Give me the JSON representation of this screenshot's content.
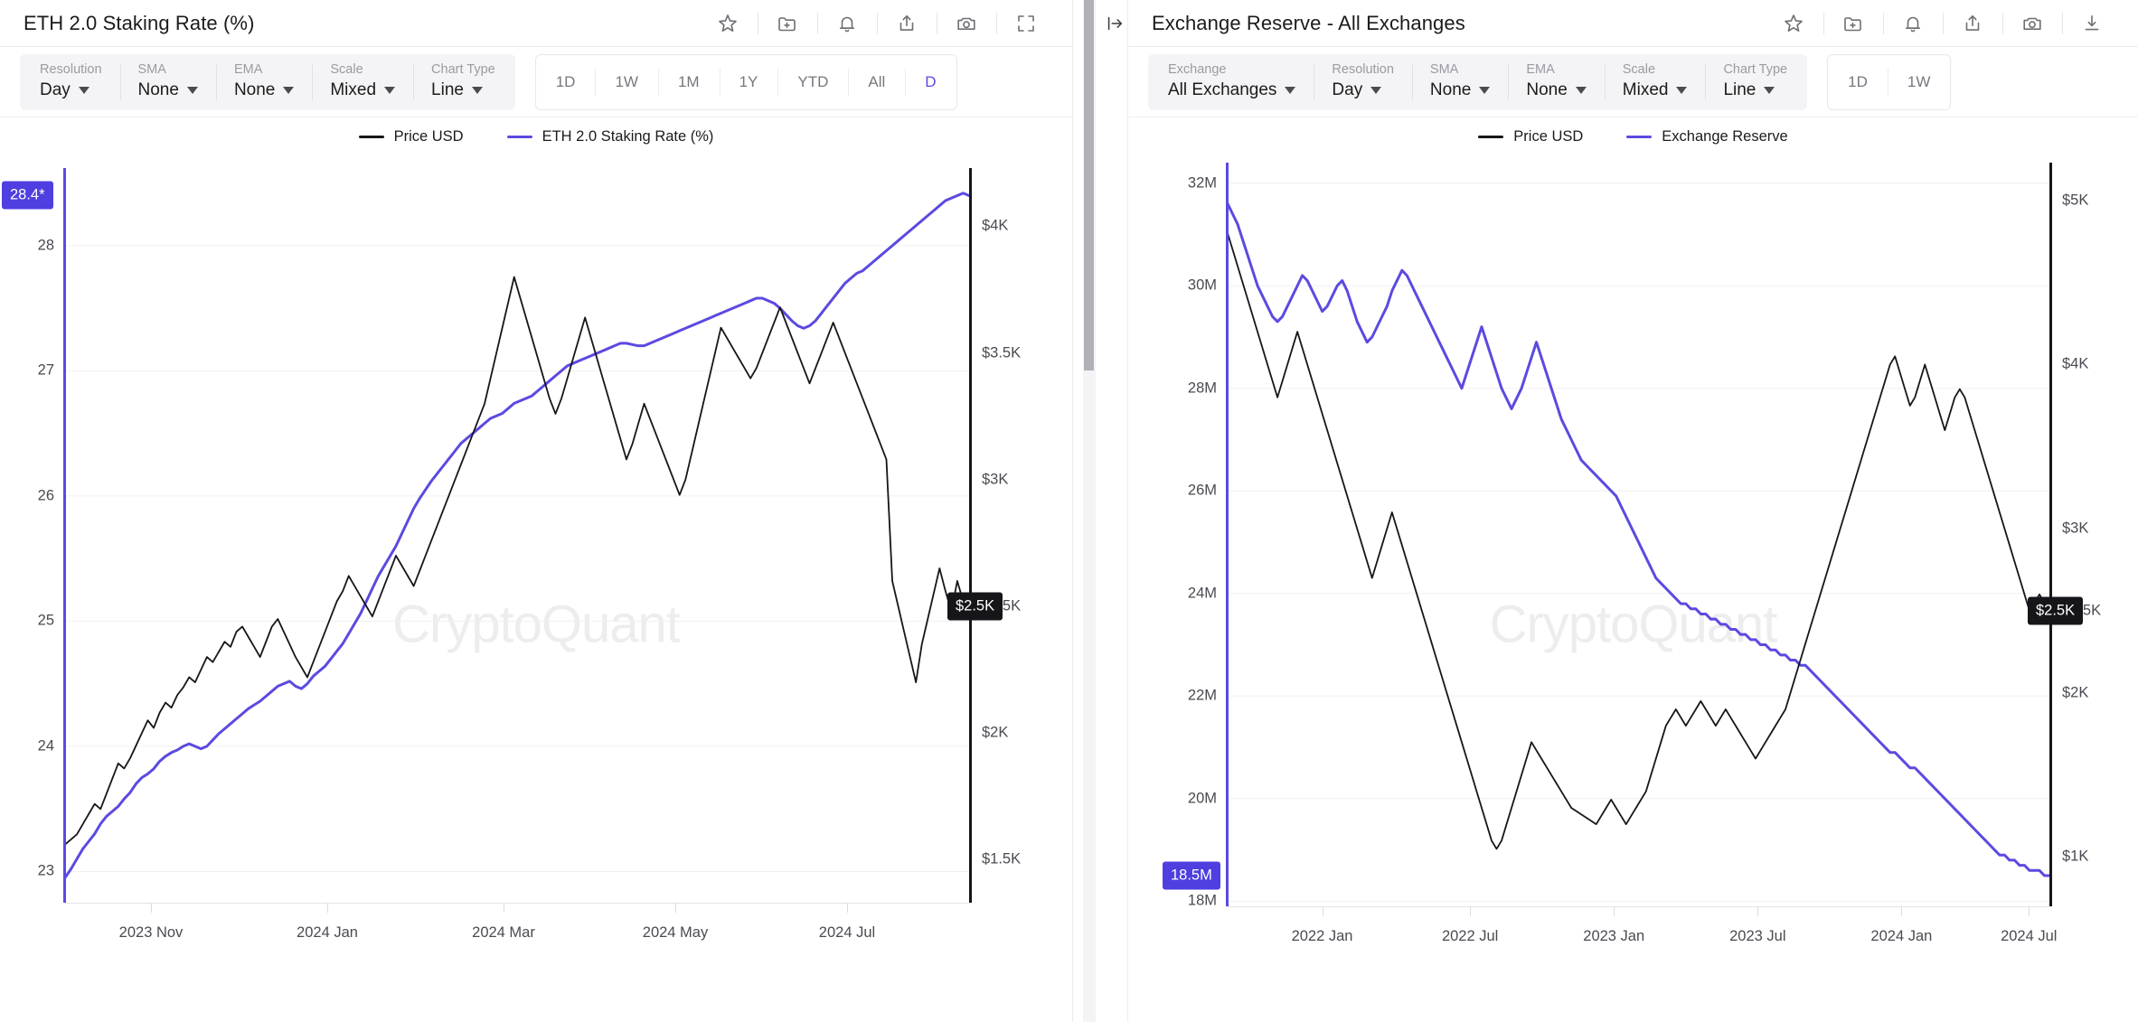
{
  "left_panel": {
    "header": {
      "title": "ETH 2.0 Staking Rate (%)",
      "icons": [
        {
          "name": "star-icon",
          "label": "Favorite"
        },
        {
          "name": "folder-plus-icon",
          "label": "Add to folder"
        },
        {
          "name": "bell-icon",
          "label": "Alert"
        },
        {
          "name": "share-icon",
          "label": "Share"
        },
        {
          "name": "camera-icon",
          "label": "Snapshot"
        },
        {
          "name": "fullscreen-icon",
          "label": "Fullscreen"
        }
      ]
    },
    "controls": [
      {
        "label": "Resolution",
        "value": "Day"
      },
      {
        "label": "SMA",
        "value": "None"
      },
      {
        "label": "EMA",
        "value": "None"
      },
      {
        "label": "Scale",
        "value": "Mixed"
      },
      {
        "label": "Chart Type",
        "value": "Line"
      }
    ],
    "ranges": [
      "1D",
      "1W",
      "1M",
      "1Y",
      "YTD",
      "All"
    ],
    "range_clipped": "D"
  },
  "right_panel": {
    "header": {
      "title": "Exchange Reserve - All Exchanges",
      "icons": [
        {
          "name": "star-icon",
          "label": "Favorite"
        },
        {
          "name": "folder-plus-icon",
          "label": "Add to folder"
        },
        {
          "name": "bell-icon",
          "label": "Alert"
        },
        {
          "name": "share-icon",
          "label": "Share"
        },
        {
          "name": "camera-icon",
          "label": "Snapshot"
        },
        {
          "name": "download-icon",
          "label": "Download"
        }
      ]
    },
    "controls": [
      {
        "label": "Exchange",
        "value": "All Exchanges"
      },
      {
        "label": "Resolution",
        "value": "Day"
      },
      {
        "label": "SMA",
        "value": "None"
      },
      {
        "label": "EMA",
        "value": "None"
      },
      {
        "label": "Scale",
        "value": "Mixed"
      },
      {
        "label": "Chart Type",
        "value": "Line"
      }
    ],
    "ranges": [
      "1D",
      "1W"
    ]
  },
  "gutter": {
    "collapse_icon": "collapse-right-icon"
  },
  "watermark": "CryptoQuant",
  "colors": {
    "metric_purple": "#5b4ae0",
    "price_black": "#16161a",
    "badge_purple": "#4f3fe0",
    "badge_black": "#16161a",
    "grid": "#f0f0f2"
  },
  "chart_data": [
    {
      "id": "eth-staking-rate",
      "type": "line",
      "title": "ETH 2.0 Staking Rate (%)",
      "xlabel": "",
      "ylabel": "ETH 2.0 Staking Rate (%)",
      "y2label": "Price USD",
      "grid": true,
      "legend_position": "top-center",
      "legend": [
        "Price USD",
        "ETH 2.0 Staking Rate (%)"
      ],
      "x_ticks": [
        "2023 Nov",
        "2024 Jan",
        "2024 Mar",
        "2024 May",
        "2024 Jul"
      ],
      "x_tick_positions": [
        0.095,
        0.29,
        0.485,
        0.675,
        0.865
      ],
      "y_ticks": [
        "28",
        "27",
        "26",
        "25",
        "24",
        "23"
      ],
      "y_tick_values": [
        28,
        27,
        26,
        25,
        24,
        23
      ],
      "ylim": [
        22.75,
        28.62
      ],
      "y2_ticks": [
        "$4K",
        "$3.5K",
        "$3K",
        "$2.5K",
        "$2K",
        "$1.5K"
      ],
      "y2_tick_values": [
        4000,
        3500,
        3000,
        2500,
        2000,
        1500
      ],
      "y2lim": [
        1330,
        4230
      ],
      "current_value_badge": {
        "text": "28.4*",
        "value": 28.4,
        "color": "#4f3fe0",
        "axis": "left"
      },
      "current_price_badge": {
        "text": "$2.5K",
        "value": 2500,
        "color": "#16161a",
        "axis": "right"
      },
      "series": [
        {
          "name": "ETH 2.0 Staking Rate (%)",
          "color": "#5b4ae0",
          "axis": "left",
          "values": [
            22.95,
            23.02,
            23.1,
            23.18,
            23.24,
            23.3,
            23.38,
            23.44,
            23.48,
            23.52,
            23.58,
            23.63,
            23.7,
            23.75,
            23.78,
            23.82,
            23.88,
            23.92,
            23.95,
            23.97,
            24.0,
            24.02,
            24.0,
            23.98,
            24.0,
            24.05,
            24.1,
            24.14,
            24.18,
            24.22,
            24.26,
            24.3,
            24.33,
            24.36,
            24.4,
            24.44,
            24.48,
            24.5,
            24.52,
            24.48,
            24.46,
            24.5,
            24.56,
            24.6,
            24.64,
            24.7,
            24.76,
            24.82,
            24.9,
            24.98,
            25.06,
            25.16,
            25.26,
            25.36,
            25.44,
            25.52,
            25.6,
            25.7,
            25.8,
            25.9,
            25.98,
            26.05,
            26.12,
            26.18,
            26.24,
            26.3,
            26.36,
            26.42,
            26.46,
            26.5,
            26.54,
            26.58,
            26.62,
            26.64,
            26.66,
            26.7,
            26.74,
            26.76,
            26.78,
            26.8,
            26.84,
            26.88,
            26.92,
            26.96,
            27.0,
            27.04,
            27.06,
            27.08,
            27.1,
            27.12,
            27.14,
            27.16,
            27.18,
            27.2,
            27.22,
            27.22,
            27.21,
            27.2,
            27.2,
            27.22,
            27.24,
            27.26,
            27.28,
            27.3,
            27.32,
            27.34,
            27.36,
            27.38,
            27.4,
            27.42,
            27.44,
            27.46,
            27.48,
            27.5,
            27.52,
            27.54,
            27.56,
            27.58,
            27.58,
            27.56,
            27.54,
            27.5,
            27.45,
            27.4,
            27.36,
            27.34,
            27.36,
            27.4,
            27.46,
            27.52,
            27.58,
            27.64,
            27.7,
            27.74,
            27.78,
            27.8,
            27.84,
            27.88,
            27.92,
            27.96,
            28.0,
            28.04,
            28.08,
            28.12,
            28.16,
            28.2,
            28.24,
            28.28,
            28.32,
            28.36,
            28.38,
            28.4,
            28.42,
            28.4
          ]
        },
        {
          "name": "Price USD",
          "color": "#16161a",
          "axis": "right",
          "values": [
            1560,
            1580,
            1600,
            1640,
            1680,
            1720,
            1700,
            1760,
            1820,
            1880,
            1860,
            1900,
            1950,
            2000,
            2050,
            2020,
            2080,
            2120,
            2100,
            2150,
            2180,
            2220,
            2200,
            2250,
            2300,
            2280,
            2320,
            2360,
            2340,
            2400,
            2420,
            2380,
            2340,
            2300,
            2360,
            2420,
            2450,
            2400,
            2350,
            2300,
            2260,
            2220,
            2280,
            2340,
            2400,
            2460,
            2520,
            2560,
            2620,
            2580,
            2540,
            2500,
            2460,
            2520,
            2580,
            2640,
            2700,
            2660,
            2620,
            2580,
            2640,
            2700,
            2760,
            2820,
            2880,
            2940,
            3000,
            3060,
            3120,
            3180,
            3240,
            3300,
            3400,
            3500,
            3600,
            3700,
            3800,
            3720,
            3640,
            3560,
            3480,
            3400,
            3320,
            3260,
            3320,
            3400,
            3480,
            3560,
            3640,
            3560,
            3480,
            3400,
            3320,
            3240,
            3160,
            3080,
            3140,
            3220,
            3300,
            3240,
            3180,
            3120,
            3060,
            3000,
            2940,
            3000,
            3100,
            3200,
            3300,
            3400,
            3500,
            3600,
            3560,
            3520,
            3480,
            3440,
            3400,
            3440,
            3500,
            3560,
            3620,
            3680,
            3620,
            3560,
            3500,
            3440,
            3380,
            3440,
            3500,
            3560,
            3620,
            3560,
            3500,
            3440,
            3380,
            3320,
            3260,
            3200,
            3140,
            3080,
            2600,
            2500,
            2400,
            2300,
            2200,
            2350,
            2450,
            2550,
            2650,
            2560,
            2480,
            2600,
            2520,
            2480
          ]
        }
      ]
    },
    {
      "id": "exchange-reserve-all-exchanges",
      "type": "line",
      "title": "Exchange Reserve - All Exchanges",
      "xlabel": "",
      "ylabel": "Exchange Reserve",
      "y2label": "Price USD",
      "grid": true,
      "legend_position": "top-center",
      "legend": [
        "Price USD",
        "Exchange Reserve"
      ],
      "x_ticks": [
        "2022 Jan",
        "2022 Jul",
        "2023 Jan",
        "2023 Jul",
        "2024 Jan",
        "2024 Jul"
      ],
      "x_tick_positions": [
        0.115,
        0.295,
        0.47,
        0.645,
        0.82,
        0.975
      ],
      "y_ticks": [
        "32M",
        "30M",
        "28M",
        "26M",
        "24M",
        "22M",
        "20M",
        "18M"
      ],
      "y_tick_values": [
        32000000,
        30000000,
        28000000,
        26000000,
        24000000,
        22000000,
        20000000,
        18000000
      ],
      "ylim": [
        17900000,
        32400000
      ],
      "y2_ticks": [
        "$5K",
        "$4K",
        "$3K",
        "$2.5K",
        "$2K",
        "$1K"
      ],
      "y2_tick_values": [
        5000,
        4000,
        3000,
        2500,
        2000,
        1000
      ],
      "y2lim": [
        700,
        5230
      ],
      "current_value_badge": {
        "text": "18.5M",
        "value": 18500000,
        "color": "#4f3fe0",
        "axis": "left"
      },
      "current_price_badge": {
        "text": "$2.5K",
        "value": 2500,
        "color": "#16161a",
        "axis": "right"
      },
      "series": [
        {
          "name": "Exchange Reserve",
          "color": "#5b4ae0",
          "axis": "left",
          "values": [
            31.6,
            31.4,
            31.2,
            30.9,
            30.6,
            30.3,
            30.0,
            29.8,
            29.6,
            29.4,
            29.3,
            29.4,
            29.6,
            29.8,
            30.0,
            30.2,
            30.1,
            29.9,
            29.7,
            29.5,
            29.6,
            29.8,
            30.0,
            30.1,
            29.9,
            29.6,
            29.3,
            29.1,
            28.9,
            29.0,
            29.2,
            29.4,
            29.6,
            29.9,
            30.1,
            30.3,
            30.2,
            30.0,
            29.8,
            29.6,
            29.4,
            29.2,
            29.0,
            28.8,
            28.6,
            28.4,
            28.2,
            28.0,
            28.3,
            28.6,
            28.9,
            29.2,
            28.9,
            28.6,
            28.3,
            28.0,
            27.8,
            27.6,
            27.8,
            28.0,
            28.3,
            28.6,
            28.9,
            28.6,
            28.3,
            28.0,
            27.7,
            27.4,
            27.2,
            27.0,
            26.8,
            26.6,
            26.5,
            26.4,
            26.3,
            26.2,
            26.1,
            26.0,
            25.9,
            25.7,
            25.5,
            25.3,
            25.1,
            24.9,
            24.7,
            24.5,
            24.3,
            24.2,
            24.1,
            24.0,
            23.9,
            23.8,
            23.8,
            23.7,
            23.7,
            23.6,
            23.6,
            23.5,
            23.5,
            23.4,
            23.4,
            23.3,
            23.3,
            23.2,
            23.2,
            23.1,
            23.1,
            23.0,
            23.0,
            22.9,
            22.9,
            22.8,
            22.8,
            22.7,
            22.7,
            22.6,
            22.6,
            22.5,
            22.4,
            22.3,
            22.2,
            22.1,
            22.0,
            21.9,
            21.8,
            21.7,
            21.6,
            21.5,
            21.4,
            21.3,
            21.2,
            21.1,
            21.0,
            20.9,
            20.9,
            20.8,
            20.7,
            20.6,
            20.6,
            20.5,
            20.4,
            20.3,
            20.2,
            20.1,
            20.0,
            19.9,
            19.8,
            19.7,
            19.6,
            19.5,
            19.4,
            19.3,
            19.2,
            19.1,
            19.0,
            18.9,
            18.9,
            18.8,
            18.8,
            18.7,
            18.7,
            18.6,
            18.6,
            18.6,
            18.5,
            18.5
          ]
        },
        {
          "name": "Price USD",
          "color": "#16161a",
          "axis": "right",
          "values": [
            4800,
            4700,
            4600,
            4500,
            4400,
            4300,
            4200,
            4100,
            4000,
            3900,
            3800,
            3900,
            4000,
            4100,
            4200,
            4100,
            4000,
            3900,
            3800,
            3700,
            3600,
            3500,
            3400,
            3300,
            3200,
            3100,
            3000,
            2900,
            2800,
            2700,
            2800,
            2900,
            3000,
            3100,
            3000,
            2900,
            2800,
            2700,
            2600,
            2500,
            2400,
            2300,
            2200,
            2100,
            2000,
            1900,
            1800,
            1700,
            1600,
            1500,
            1400,
            1300,
            1200,
            1100,
            1050,
            1100,
            1200,
            1300,
            1400,
            1500,
            1600,
            1700,
            1650,
            1600,
            1550,
            1500,
            1450,
            1400,
            1350,
            1300,
            1280,
            1260,
            1240,
            1220,
            1200,
            1250,
            1300,
            1350,
            1300,
            1250,
            1200,
            1250,
            1300,
            1350,
            1400,
            1500,
            1600,
            1700,
            1800,
            1850,
            1900,
            1850,
            1800,
            1850,
            1900,
            1950,
            1900,
            1850,
            1800,
            1850,
            1900,
            1850,
            1800,
            1750,
            1700,
            1650,
            1600,
            1650,
            1700,
            1750,
            1800,
            1850,
            1900,
            2000,
            2100,
            2200,
            2300,
            2400,
            2500,
            2600,
            2700,
            2800,
            2900,
            3000,
            3100,
            3200,
            3300,
            3400,
            3500,
            3600,
            3700,
            3800,
            3900,
            4000,
            4050,
            3950,
            3850,
            3750,
            3800,
            3900,
            4000,
            3900,
            3800,
            3700,
            3600,
            3700,
            3800,
            3850,
            3800,
            3700,
            3600,
            3500,
            3400,
            3300,
            3200,
            3100,
            3000,
            2900,
            2800,
            2700,
            2600,
            2500,
            2550,
            2600,
            2550,
            2500
          ]
        }
      ]
    }
  ]
}
